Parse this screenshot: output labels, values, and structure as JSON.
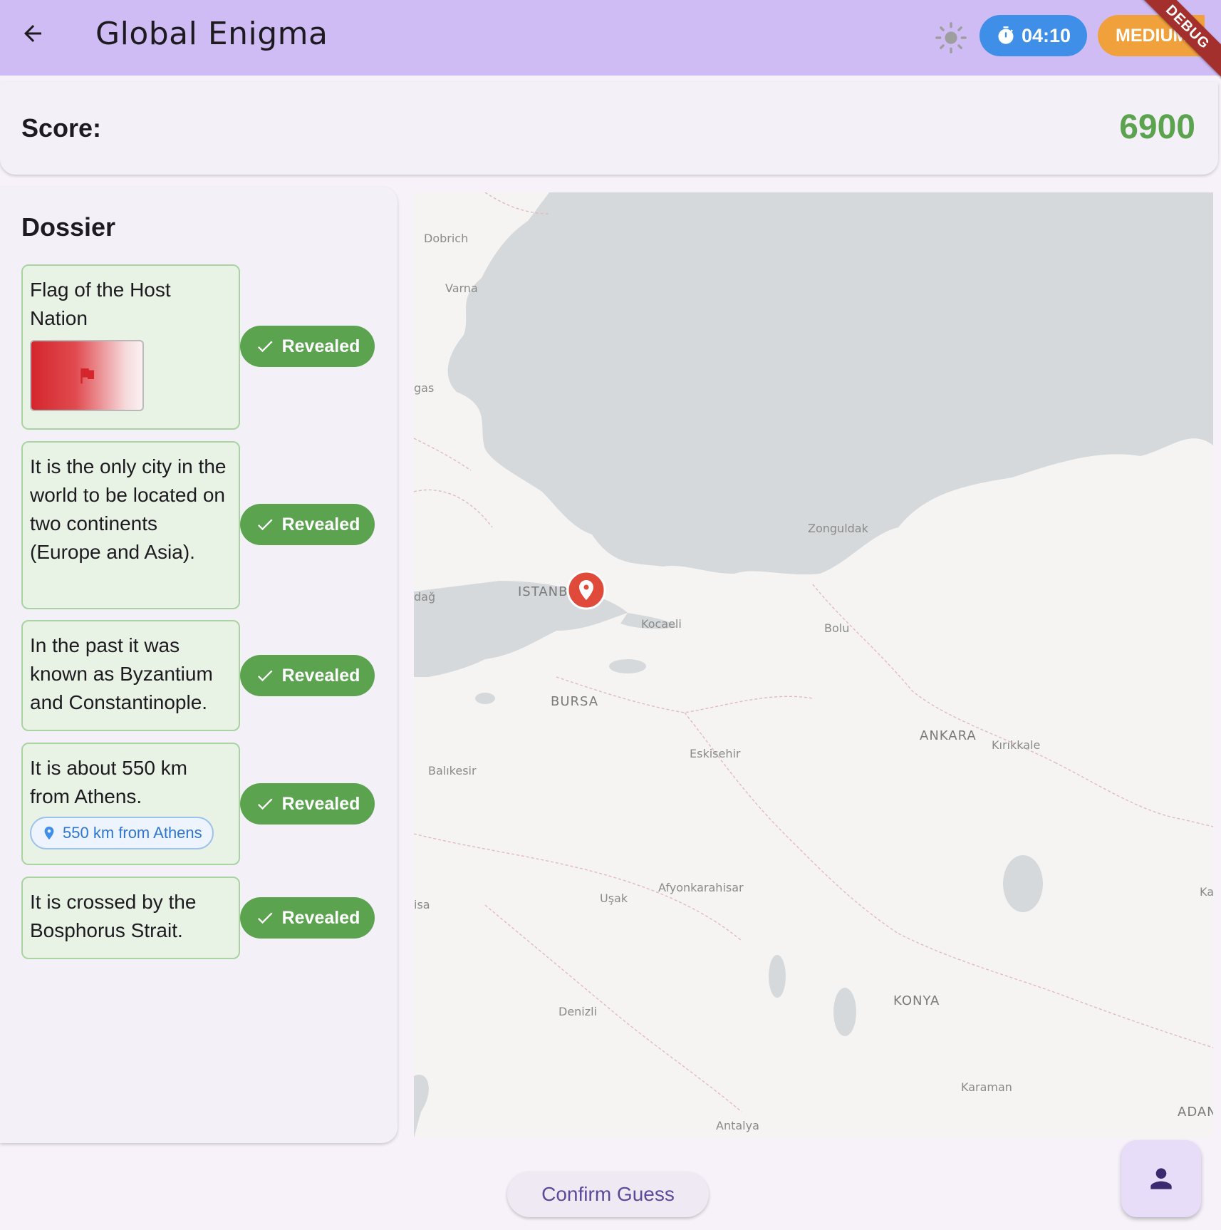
{
  "appbar": {
    "title": "Global Enigma",
    "timer": "04:10",
    "difficulty": "MEDIUM",
    "debug_banner": "DEBUG",
    "icons": [
      "arrow-back-icon",
      "sun-icon",
      "timer-icon"
    ]
  },
  "score": {
    "label": "Score:",
    "value": "6900",
    "color": "#5ba34f"
  },
  "dossier": {
    "title": "Dossier",
    "clues": [
      {
        "text": "Flag of the Host Nation",
        "status": "Revealed"
      },
      {
        "text": "It is the only city in the world to be located on two continents (Europe and Asia).",
        "status": "Revealed"
      },
      {
        "text": "In the past it was known as Byzantium and Constantinople.",
        "status": "Revealed"
      },
      {
        "text": "It is about 550 km from Athens.",
        "status": "Revealed",
        "chip": "550 km from Athens"
      },
      {
        "text": "It is crossed by the Bosphorus Strait.",
        "status": "Revealed"
      }
    ]
  },
  "map": {
    "labels": [
      "Dobrich",
      "Varna",
      "gas",
      "Zonguldak",
      "dağ",
      "ISTANB",
      "Kocaeli",
      "Bolu",
      "BURSA",
      "ANKARA",
      "Kırıkkale",
      "Eskisehir",
      "Balıkesir",
      "Afyonkarahisar",
      "Uşak",
      "isa",
      "Ka",
      "KONYA",
      "Denizli",
      "Karaman",
      "ADAN",
      "Antalya"
    ]
  },
  "actions": {
    "confirm": "Confirm Guess"
  },
  "colors": {
    "appbar": "#d0bcf5",
    "timer": "#3f8fe8",
    "difficulty": "#f0a13c",
    "revealed": "#5ba34f",
    "marker": "#e04a3a"
  }
}
